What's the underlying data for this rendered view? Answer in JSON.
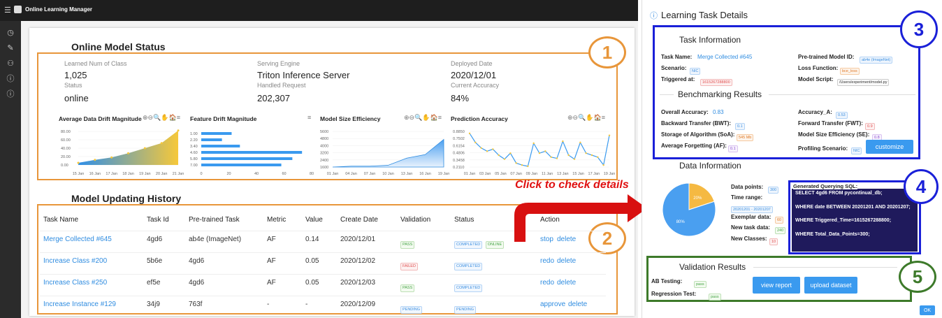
{
  "topbar": {
    "menu_icon": "hamburger-icon",
    "app_icon": "app-logo-icon",
    "title": "Online Learning Manager"
  },
  "sidebar": {
    "icons": [
      "dashboard-icon",
      "edit-icon",
      "user-icon",
      "info-icon",
      "info-icon"
    ]
  },
  "status": {
    "title": "Online Model Status",
    "fields": [
      {
        "label": "Learned Num of Class",
        "value": "1,025"
      },
      {
        "label": "Serving Engine",
        "value": "Triton Inference Server"
      },
      {
        "label": "Deployed Date",
        "value": "2020/12/01"
      },
      {
        "label": "Status",
        "value": "online"
      },
      {
        "label": "Handled Request",
        "value": "202,307"
      },
      {
        "label": "Current Accuracy",
        "value": "84%"
      }
    ],
    "badge": "1"
  },
  "charts_titles": {
    "c1": "Average Data Drift Magnitude",
    "c2": "Feature Drift Magnitude",
    "c3": "Model Size Efficiency",
    "c4": "Prediction Accuracy",
    "tools": "⊕⊖🔍✋🏠≡",
    "menu": "≡"
  },
  "chart_data": [
    {
      "type": "area",
      "title": "Average Data Drift Magnitude",
      "x": [
        "15 Jan",
        "16 Jan",
        "17 Jan",
        "18 Jan",
        "19 Jan",
        "20 Jan",
        "21 Jan"
      ],
      "y": [
        5,
        12,
        18,
        28,
        40,
        52,
        82
      ],
      "yticks": [
        "80.00",
        "60.00",
        "40.00",
        "20.00",
        "0.00"
      ],
      "ylim": [
        0,
        80
      ]
    },
    {
      "type": "bar",
      "title": "Feature Drift Magnitude",
      "orientation": "horizontal",
      "categories": [
        "1.00",
        "2.20",
        "3.40",
        "4.60",
        "5.80",
        "7.00"
      ],
      "values": [
        22,
        15,
        28,
        73,
        66,
        58
      ],
      "xticks": [
        "0",
        "20",
        "40",
        "60",
        "80"
      ],
      "xlim": [
        0,
        80
      ]
    },
    {
      "type": "area",
      "title": "Model Size Efficiency",
      "x": [
        "01 Jan",
        "04 Jan",
        "07 Jan",
        "10 Jan",
        "13 Jan",
        "16 Jan",
        "19 Jan"
      ],
      "y": [
        1600,
        1700,
        1700,
        1800,
        2600,
        3000,
        4700
      ],
      "yticks": [
        "5600",
        "4800",
        "4000",
        "3200",
        "2400",
        "1600"
      ],
      "ylim": [
        1600,
        5600
      ]
    },
    {
      "type": "line",
      "title": "Prediction Accuracy",
      "x": [
        "01 Jan",
        "03 Jan",
        "05 Jan",
        "07 Jan",
        "09 Jan",
        "11 Jan",
        "13 Jan",
        "15 Jan",
        "17 Jan",
        "19 Jan"
      ],
      "y": [
        0.85,
        0.62,
        0.48,
        0.4,
        0.45,
        0.3,
        0.2,
        0.35,
        0.1,
        0.05,
        0.02,
        0.6,
        0.35,
        0.4,
        0.25,
        0.22,
        0.65,
        0.3,
        0.2,
        0.62,
        0.35,
        0.3,
        0.25,
        0.05,
        0.8
      ],
      "yticks": [
        "0.8850",
        "0.7502",
        "0.6154",
        "0.4806",
        "0.3458",
        "0.2110"
      ],
      "ylim": [
        0,
        0.9
      ]
    }
  ],
  "history": {
    "title": "Model Updating History",
    "badge": "2",
    "headers": [
      "Task Name",
      "Task Id",
      "Pre-trained Task",
      "Metric",
      "Value",
      "Create Date",
      "Validation",
      "Status",
      "Action"
    ],
    "rows": [
      {
        "name": "Merge Collected #645",
        "id": "4gd6",
        "pre": "ab4e (ImageNet)",
        "metric": "AF",
        "value": "0.14",
        "date": "2020/12/01",
        "validation": "PASS",
        "status": "COMPLETED",
        "status2": "ONLINE",
        "act1": "stop",
        "act2": "delete"
      },
      {
        "name": "Increase Class #200",
        "id": "5b6e",
        "pre": "4gd6",
        "metric": "AF",
        "value": "0.05",
        "date": "2020/12/02",
        "validation": "FAILED",
        "status": "COMPLETED",
        "status2": "",
        "act1": "redo",
        "act2": "delete"
      },
      {
        "name": "Increase Class #250",
        "id": "ef5e",
        "pre": "4gd6",
        "metric": "AF",
        "value": "0.05",
        "date": "2020/12/03",
        "validation": "PASS",
        "status": "COMPLETED",
        "status2": "",
        "act1": "redo",
        "act2": "delete"
      },
      {
        "name": "Increase Instance #129",
        "id": "34j9",
        "pre": "763f",
        "metric": "-",
        "value": "-",
        "date": "2020/12/09",
        "validation": "PENDING",
        "status": "PENDING",
        "status2": "",
        "act1": "approve",
        "act2": "delete"
      }
    ]
  },
  "callout": {
    "text": "Click to check details"
  },
  "panel": {
    "title": "Learning Task Details",
    "task_info": {
      "title": "Task Information",
      "badge": "3",
      "task_name_l": "Task Name:",
      "task_name_v": "Merge Collected #645",
      "scenario_l": "Scenario:",
      "scenario_v": "NIC",
      "triggered_l": "Triggered at:",
      "triggered_v": "1615267288800",
      "pretrained_l": "Pre-trained Model ID:",
      "pretrained_v": "ab4e (ImageNet)",
      "loss_l": "Loss Function:",
      "loss_v": "bce_loss",
      "script_l": "Model Script:",
      "script_v": "/Users/experiment/model.py"
    },
    "bench": {
      "title": "Benchmarking Results",
      "oa_l": "Overall Accuracy:",
      "oa_v": "0.83",
      "bwt_l": "Backward Transfer (BWT):",
      "bwt_v": "0.1",
      "soa_l": "Storage of Algorithm (SoA):",
      "soa_v": "545 Mb",
      "af_l": "Average Forgetting (AF):",
      "af_v": "0.1",
      "acca_l": "Accuracy_A:",
      "acca_v": "0.53",
      "fwt_l": "Forward Transfer (FWT):",
      "fwt_v": "0.9",
      "se_l": "Model Size Efficiency (SE):",
      "se_v": "0.8",
      "prof_l": "Profiling Scenario:",
      "prof_v": "NIC",
      "customize": "customize"
    },
    "data_info": {
      "title": "Data Information",
      "badge": "4",
      "pie": [
        {
          "label": "20%",
          "value": 20,
          "color": "#f5b942"
        },
        {
          "label": "80%",
          "value": 80,
          "color": "#4a9ff0"
        }
      ],
      "dp_l": "Data points:",
      "dp_v": "300",
      "tr_l": "Time range:",
      "tr_v": "20201201 - 20201207",
      "ex_l": "Exemplar data:",
      "ex_v": "60",
      "nt_l": "New task data:",
      "nt_v": "240",
      "nc_l": "New Classes:",
      "nc_v": "10",
      "sql_title": "Generated Querying SQL:",
      "sql1": "SELECT 4gd6 FROM pycontinual_db;",
      "sql2": "WHERE date BETWEEN 20201201 AND 20201207;",
      "sql3": "WHERE Triggered_Time=1615267288800;",
      "sql4": "WHERE Total_Data_Points=300;"
    },
    "validation": {
      "title": "Validation Results",
      "badge": "5",
      "ab_l": "AB Testing:",
      "ab_v": "pass",
      "reg_l": "Regression Test:",
      "reg_v": "pass",
      "view": "view report",
      "upload": "upload dataset"
    },
    "ok": "OK"
  },
  "colors": {
    "orange": "#e8963a",
    "blue_box": "#1a20d8",
    "green_box": "#3d7a2a",
    "accent": "#3a9aef",
    "callout": "#e01010"
  }
}
